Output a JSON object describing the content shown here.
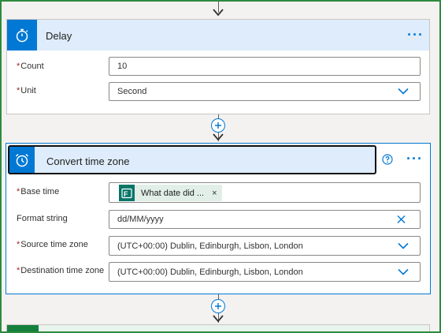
{
  "delay": {
    "title": "Delay",
    "count_label": "Count",
    "count_value": "10",
    "unit_label": "Unit",
    "unit_value": "Second"
  },
  "convert": {
    "title": "Convert time zone",
    "base_time_label": "Base time",
    "base_time_token": "What date did ...",
    "format_label": "Format string",
    "format_value": "dd/MM/yyyy",
    "source_label": "Source time zone",
    "source_value": "(UTC+00:00) Dublin, Edinburgh, Lisbon, London",
    "destination_label": "Destination time zone",
    "destination_value": "(UTC+00:00) Dublin, Edinburgh, Lisbon, London"
  },
  "colors": {
    "accent": "#0078d4",
    "header_bg": "#deecfb",
    "required": "#a4262c",
    "token_bg": "#e1efe7",
    "token_icon": "#077568",
    "frame": "#2e8b3e"
  },
  "icons": {
    "delay": "stopwatch-icon",
    "convert": "alarm-clock-icon",
    "token": "forms-icon",
    "help": "help-circle-icon",
    "more": "ellipsis-icon",
    "dropdown": "chevron-down-icon",
    "clear": "close-icon",
    "add": "plus-icon"
  }
}
